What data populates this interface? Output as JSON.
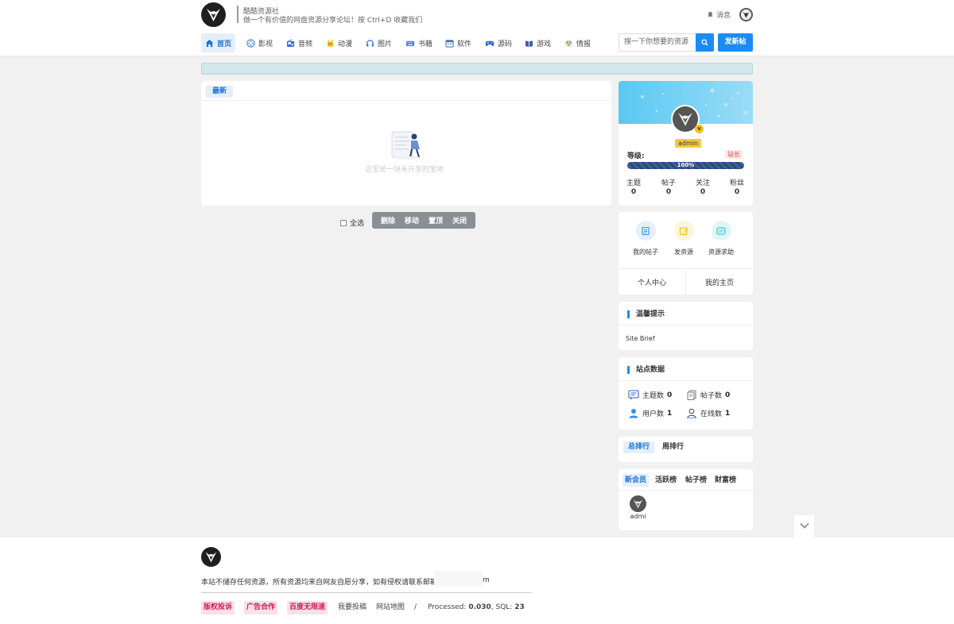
{
  "site": {
    "name": "酷酷资源社",
    "description": "做一个有价值的网盘资源分享论坛！按 Ctrl+D 收藏我们"
  },
  "header": {
    "messages": "消息"
  },
  "nav": [
    {
      "label": "首页",
      "icon": "home-icon",
      "active": true
    },
    {
      "label": "影视",
      "icon": "film-reel-icon"
    },
    {
      "label": "音频",
      "icon": "radio-icon"
    },
    {
      "label": "动漫",
      "icon": "anime-icon"
    },
    {
      "label": "图片",
      "icon": "headphones-icon"
    },
    {
      "label": "书籍",
      "icon": "keyboard-icon"
    },
    {
      "label": "软件",
      "icon": "calendar-icon"
    },
    {
      "label": "源码",
      "icon": "gamepad-icon"
    },
    {
      "label": "游戏",
      "icon": "book-icon"
    },
    {
      "label": "情报",
      "icon": "dots-icon"
    }
  ],
  "search": {
    "placeholder": "搜一下你想要的资源"
  },
  "post_button": "发新帖",
  "main": {
    "tab": "最新",
    "empty_text": "这里是一块未开发的宝地"
  },
  "bulk": {
    "select_all": "全选",
    "actions": [
      "删除",
      "移动",
      "置顶",
      "关闭"
    ]
  },
  "profile": {
    "username": "admin",
    "level_label": "等级:",
    "role": "站长",
    "progress": "100%",
    "stats": [
      {
        "label": "主题",
        "value": "0"
      },
      {
        "label": "帖子",
        "value": "0"
      },
      {
        "label": "关注",
        "value": "0"
      },
      {
        "label": "粉丝",
        "value": "0"
      }
    ]
  },
  "quick": {
    "items": [
      {
        "label": "我的帖子",
        "icon": "document-icon",
        "color": "#2f8ef3"
      },
      {
        "label": "发资源",
        "icon": "edit-icon",
        "color": "#f2b705"
      },
      {
        "label": "资源求助",
        "icon": "help-icon",
        "color": "#1fbfc7"
      }
    ],
    "links": [
      "个人中心",
      "我的主页"
    ]
  },
  "tips": {
    "title": "温馨提示",
    "body": "Site Brief"
  },
  "site_stats": {
    "title": "站点数据",
    "items": [
      {
        "label": "主题数",
        "value": "0"
      },
      {
        "label": "帖子数",
        "value": "0"
      },
      {
        "label": "用户数",
        "value": "1"
      },
      {
        "label": "在线数",
        "value": "1"
      }
    ]
  },
  "rank": {
    "tabs": [
      "总排行",
      "周排行"
    ]
  },
  "members": {
    "tabs": [
      "新会员",
      "活跃榜",
      "帖子榜",
      "财富榜"
    ],
    "list": [
      {
        "name": "admi"
      }
    ]
  },
  "footer": {
    "text": "本站不储存任何资源，所有资源均来自网友自愿分享，如有侵权请联系邮箱：",
    "text_tail": "m",
    "tags": [
      "版权投诉",
      "广告合作",
      "百度无限速"
    ],
    "links": [
      "我要投稿",
      "网站地图",
      "/"
    ],
    "processed_label": "Processed:",
    "processed": "0.030",
    "sql_label": ", SQL:",
    "sql": "23"
  },
  "colors": {
    "accent": "#1b8cf5",
    "tag_red": "#d31a52",
    "notice_bg": "#d2e7ea"
  }
}
